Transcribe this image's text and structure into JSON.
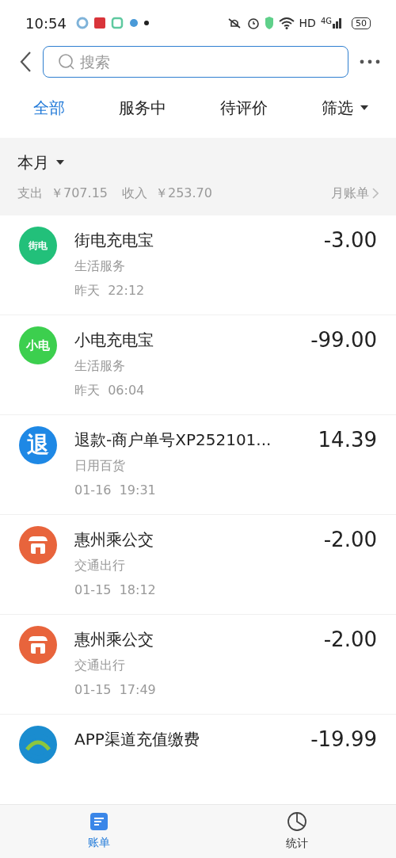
{
  "status_bar": {
    "time": "10:54",
    "network": "HD",
    "cell": "4G",
    "battery": "50"
  },
  "search": {
    "placeholder": "搜索"
  },
  "tabs": [
    {
      "label": "全部",
      "selected": true
    },
    {
      "label": "服务中",
      "selected": false
    },
    {
      "label": "待评价",
      "selected": false
    },
    {
      "label": "筛选",
      "selected": false,
      "kind": "dropdown"
    }
  ],
  "summary": {
    "period": "本月",
    "expense_label": "支出",
    "expense": "￥707.15",
    "income_label": "收入",
    "income": "￥253.70",
    "monthly_bill": "月账单"
  },
  "transactions": [
    {
      "kind": "jiedian",
      "logo_text": "街电",
      "color": "#22c07a",
      "title": "街电充电宝",
      "category": "生活服务",
      "time": "昨天  22:12",
      "amount": "-3.00"
    },
    {
      "kind": "xiaodian",
      "logo_text": "小电",
      "color": "#3ccf4e",
      "title": "小电充电宝",
      "category": "生活服务",
      "time": "昨天  06:04",
      "amount": "-99.00"
    },
    {
      "kind": "refund",
      "logo_text": "退",
      "color": "#1e88e5",
      "title": "退款-商户单号XP252101...",
      "category": "日用百货",
      "time": "01-16  19:31",
      "amount": "14.39"
    },
    {
      "kind": "bus",
      "color": "#e8643c",
      "title": "惠州乘公交",
      "category": "交通出行",
      "time": "01-15  18:12",
      "amount": "-2.00"
    },
    {
      "kind": "bus",
      "color": "#e8643c",
      "title": "惠州乘公交",
      "category": "交通出行",
      "time": "01-15  17:49",
      "amount": "-2.00"
    },
    {
      "kind": "mobile",
      "color": "#1a8ccf",
      "title": "APP渠道充值缴费",
      "amount": "-19.99"
    }
  ],
  "bottom_nav": [
    {
      "label": "账单",
      "selected": true,
      "kind": "bill"
    },
    {
      "label": "统计",
      "selected": false,
      "kind": "stats"
    }
  ]
}
